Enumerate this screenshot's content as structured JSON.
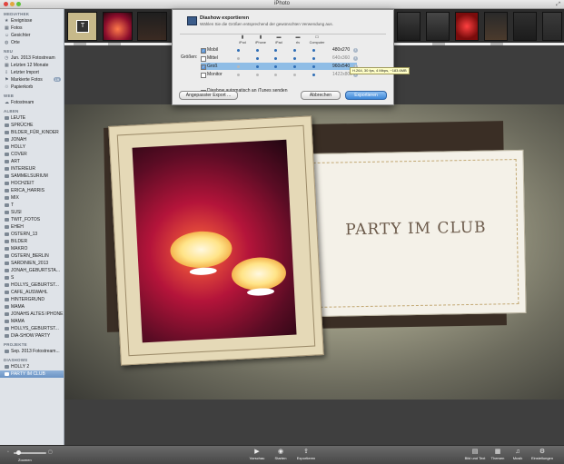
{
  "window": {
    "title": "iPhoto"
  },
  "sidebar": {
    "sections": [
      {
        "label": "MEDIATHEK",
        "items": [
          {
            "label": "Ereignisse",
            "icon": "star-icon"
          },
          {
            "label": "Fotos",
            "icon": "photos-icon"
          },
          {
            "label": "Gesichter",
            "icon": "faces-icon"
          },
          {
            "label": "Orte",
            "icon": "globe-icon"
          }
        ]
      },
      {
        "label": "NEU",
        "items": [
          {
            "label": "Jun. 2013 Fotostream",
            "icon": "clock-icon"
          },
          {
            "label": "Letzten 12 Monate",
            "icon": "calendar-icon"
          },
          {
            "label": "Letzter Import",
            "icon": "import-icon"
          },
          {
            "label": "Markierte Fotos",
            "icon": "flag-icon",
            "badge": "19"
          },
          {
            "label": "Papierkorb",
            "icon": "trash-icon"
          }
        ]
      },
      {
        "label": "WEB",
        "items": [
          {
            "label": "Fotostream",
            "icon": "cloud-icon"
          }
        ]
      },
      {
        "label": "ALBEN",
        "items": [
          {
            "label": "LEUTE"
          },
          {
            "label": "SPRÜCHE"
          },
          {
            "label": "BILDER_FÜR_KINDER"
          },
          {
            "label": "JONAH"
          },
          {
            "label": "HOLLY"
          },
          {
            "label": "COVER"
          },
          {
            "label": "ART"
          },
          {
            "label": "INTERIEUR"
          },
          {
            "label": "SAMMELSURIUM"
          },
          {
            "label": "HOCHZEIT"
          },
          {
            "label": "ERICA_HARRIS"
          },
          {
            "label": "MIX"
          },
          {
            "label": "T"
          },
          {
            "label": "SUSI"
          },
          {
            "label": "TWIT_FOTOS"
          },
          {
            "label": "EHEH"
          },
          {
            "label": "OSTERN_13"
          },
          {
            "label": "BILDER"
          },
          {
            "label": "MAKRO"
          },
          {
            "label": "OSTERN_BERLIN"
          },
          {
            "label": "SARDINIEN_2013"
          },
          {
            "label": "JONAH_GEBURTSTA..."
          },
          {
            "label": "S"
          },
          {
            "label": "HOLLYS_GEBURTST..."
          },
          {
            "label": "CAFE_AUSWAHL"
          },
          {
            "label": "HINTERGRUND"
          },
          {
            "label": "MAMA"
          },
          {
            "label": "JONAHS ALTES IPHONE"
          },
          {
            "label": "MAMA"
          },
          {
            "label": "HOLLYS_GEBURTST..."
          },
          {
            "label": "DIA-SHOW PARTY"
          }
        ]
      },
      {
        "label": "PROJEKTE",
        "items": [
          {
            "label": "Sep. 2013 Fotostream..."
          }
        ]
      },
      {
        "label": "DIASHOWS",
        "items": [
          {
            "label": "HOLLY 2"
          },
          {
            "label": "PARTY IM CLUB",
            "selected": true
          }
        ]
      }
    ]
  },
  "dialog": {
    "title": "Diashow exportieren",
    "subtitle": "Wählen Sie die Größen entsprechend der gewünschten Verwendung aus.",
    "devices": [
      "iPod",
      "iPhone",
      "iPad",
      "▪tv",
      "Computer"
    ],
    "sizes_label": "Größen:",
    "rows": [
      {
        "name": "Mobil",
        "checked": true,
        "size": "480x270",
        "dots": [
          true,
          true,
          true,
          true,
          true
        ]
      },
      {
        "name": "Mittel",
        "checked": false,
        "size": "640x360",
        "dots": [
          false,
          true,
          true,
          true,
          true
        ]
      },
      {
        "name": "Groß",
        "checked": true,
        "size": "960x540",
        "dots": [
          false,
          true,
          true,
          true,
          true
        ],
        "highlighted": true
      },
      {
        "name": "Monitor",
        "checked": false,
        "size": "1422x800",
        "dots": [
          false,
          false,
          false,
          false,
          true
        ]
      }
    ],
    "tooltip": "H.264, 30 fps, 4 Mbps, ~183.6MB",
    "itunes_label": "Diashow automatisch an iTunes senden",
    "custom_export": "Angepasster Export ...",
    "cancel": "Abbrechen",
    "export": "Exportieren"
  },
  "slide": {
    "title": "PARTY IM CLUB"
  },
  "toolbar": {
    "zoom": "Zoomen",
    "buttons": [
      "Vorschau",
      "Starten",
      "Exportieren"
    ],
    "right_buttons": [
      "Bild und Text",
      "Themen",
      "Musik",
      "Einstellungen"
    ]
  },
  "colors": {
    "selection": "#6b93c4",
    "accent": "#3d86d7"
  }
}
